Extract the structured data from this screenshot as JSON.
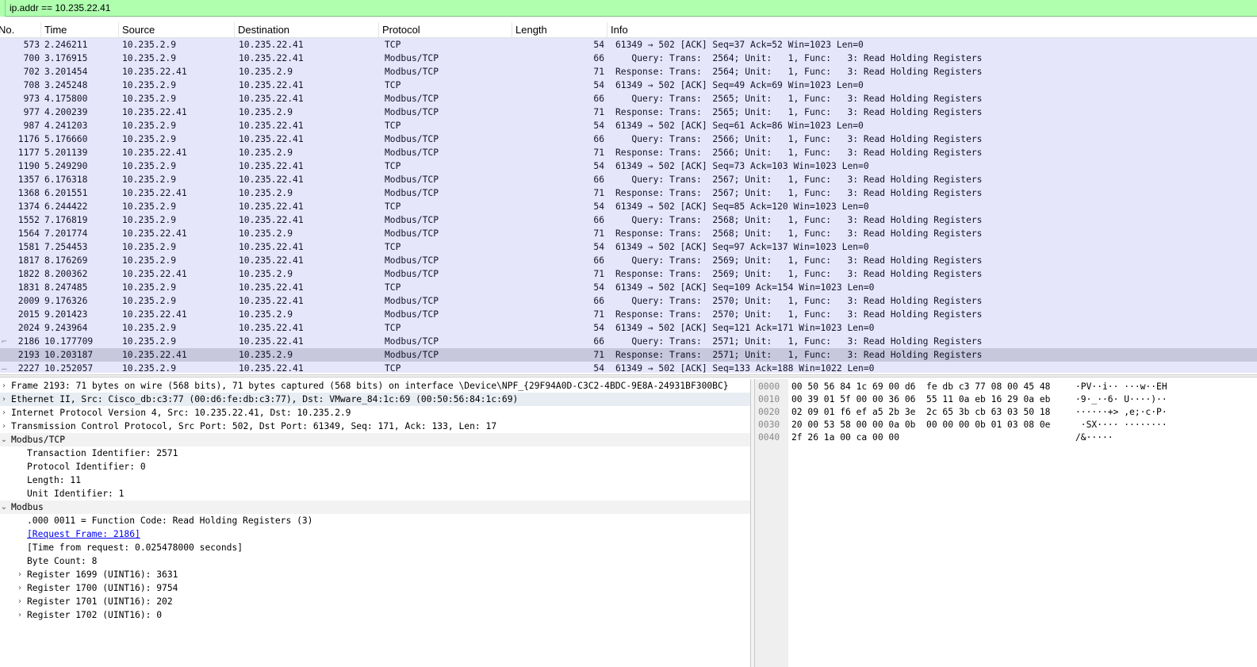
{
  "filter": {
    "value": "ip.addr == 10.235.22.41"
  },
  "packet_list": {
    "columns": {
      "no": "No.",
      "time": "Time",
      "source": "Source",
      "destination": "Destination",
      "protocol": "Protocol",
      "length": "Length",
      "info": "Info"
    },
    "rows": [
      {
        "no": "573",
        "time": "2.246211",
        "src": "10.235.2.9",
        "dst": "10.235.22.41",
        "proto": "TCP",
        "len": "54",
        "info": "61349 → 502 [ACK] Seq=37 Ack=52 Win=1023 Len=0"
      },
      {
        "no": "700",
        "time": "3.176915",
        "src": "10.235.2.9",
        "dst": "10.235.22.41",
        "proto": "Modbus/TCP",
        "len": "66",
        "info": "   Query: Trans:  2564; Unit:   1, Func:   3: Read Holding Registers"
      },
      {
        "no": "702",
        "time": "3.201454",
        "src": "10.235.22.41",
        "dst": "10.235.2.9",
        "proto": "Modbus/TCP",
        "len": "71",
        "info": "Response: Trans:  2564; Unit:   1, Func:   3: Read Holding Registers"
      },
      {
        "no": "708",
        "time": "3.245248",
        "src": "10.235.2.9",
        "dst": "10.235.22.41",
        "proto": "TCP",
        "len": "54",
        "info": "61349 → 502 [ACK] Seq=49 Ack=69 Win=1023 Len=0"
      },
      {
        "no": "973",
        "time": "4.175800",
        "src": "10.235.2.9",
        "dst": "10.235.22.41",
        "proto": "Modbus/TCP",
        "len": "66",
        "info": "   Query: Trans:  2565; Unit:   1, Func:   3: Read Holding Registers"
      },
      {
        "no": "977",
        "time": "4.200239",
        "src": "10.235.22.41",
        "dst": "10.235.2.9",
        "proto": "Modbus/TCP",
        "len": "71",
        "info": "Response: Trans:  2565; Unit:   1, Func:   3: Read Holding Registers"
      },
      {
        "no": "987",
        "time": "4.241203",
        "src": "10.235.2.9",
        "dst": "10.235.22.41",
        "proto": "TCP",
        "len": "54",
        "info": "61349 → 502 [ACK] Seq=61 Ack=86 Win=1023 Len=0"
      },
      {
        "no": "1176",
        "time": "5.176660",
        "src": "10.235.2.9",
        "dst": "10.235.22.41",
        "proto": "Modbus/TCP",
        "len": "66",
        "info": "   Query: Trans:  2566; Unit:   1, Func:   3: Read Holding Registers"
      },
      {
        "no": "1177",
        "time": "5.201139",
        "src": "10.235.22.41",
        "dst": "10.235.2.9",
        "proto": "Modbus/TCP",
        "len": "71",
        "info": "Response: Trans:  2566; Unit:   1, Func:   3: Read Holding Registers"
      },
      {
        "no": "1190",
        "time": "5.249290",
        "src": "10.235.2.9",
        "dst": "10.235.22.41",
        "proto": "TCP",
        "len": "54",
        "info": "61349 → 502 [ACK] Seq=73 Ack=103 Win=1023 Len=0"
      },
      {
        "no": "1357",
        "time": "6.176318",
        "src": "10.235.2.9",
        "dst": "10.235.22.41",
        "proto": "Modbus/TCP",
        "len": "66",
        "info": "   Query: Trans:  2567; Unit:   1, Func:   3: Read Holding Registers"
      },
      {
        "no": "1368",
        "time": "6.201551",
        "src": "10.235.22.41",
        "dst": "10.235.2.9",
        "proto": "Modbus/TCP",
        "len": "71",
        "info": "Response: Trans:  2567; Unit:   1, Func:   3: Read Holding Registers"
      },
      {
        "no": "1374",
        "time": "6.244422",
        "src": "10.235.2.9",
        "dst": "10.235.22.41",
        "proto": "TCP",
        "len": "54",
        "info": "61349 → 502 [ACK] Seq=85 Ack=120 Win=1023 Len=0"
      },
      {
        "no": "1552",
        "time": "7.176819",
        "src": "10.235.2.9",
        "dst": "10.235.22.41",
        "proto": "Modbus/TCP",
        "len": "66",
        "info": "   Query: Trans:  2568; Unit:   1, Func:   3: Read Holding Registers"
      },
      {
        "no": "1564",
        "time": "7.201774",
        "src": "10.235.22.41",
        "dst": "10.235.2.9",
        "proto": "Modbus/TCP",
        "len": "71",
        "info": "Response: Trans:  2568; Unit:   1, Func:   3: Read Holding Registers"
      },
      {
        "no": "1581",
        "time": "7.254453",
        "src": "10.235.2.9",
        "dst": "10.235.22.41",
        "proto": "TCP",
        "len": "54",
        "info": "61349 → 502 [ACK] Seq=97 Ack=137 Win=1023 Len=0"
      },
      {
        "no": "1817",
        "time": "8.176269",
        "src": "10.235.2.9",
        "dst": "10.235.22.41",
        "proto": "Modbus/TCP",
        "len": "66",
        "info": "   Query: Trans:  2569; Unit:   1, Func:   3: Read Holding Registers"
      },
      {
        "no": "1822",
        "time": "8.200362",
        "src": "10.235.22.41",
        "dst": "10.235.2.9",
        "proto": "Modbus/TCP",
        "len": "71",
        "info": "Response: Trans:  2569; Unit:   1, Func:   3: Read Holding Registers"
      },
      {
        "no": "1831",
        "time": "8.247485",
        "src": "10.235.2.9",
        "dst": "10.235.22.41",
        "proto": "TCP",
        "len": "54",
        "info": "61349 → 502 [ACK] Seq=109 Ack=154 Win=1023 Len=0"
      },
      {
        "no": "2009",
        "time": "9.176326",
        "src": "10.235.2.9",
        "dst": "10.235.22.41",
        "proto": "Modbus/TCP",
        "len": "66",
        "info": "   Query: Trans:  2570; Unit:   1, Func:   3: Read Holding Registers"
      },
      {
        "no": "2015",
        "time": "9.201423",
        "src": "10.235.22.41",
        "dst": "10.235.2.9",
        "proto": "Modbus/TCP",
        "len": "71",
        "info": "Response: Trans:  2570; Unit:   1, Func:   3: Read Holding Registers"
      },
      {
        "no": "2024",
        "time": "9.243964",
        "src": "10.235.2.9",
        "dst": "10.235.22.41",
        "proto": "TCP",
        "len": "54",
        "info": "61349 → 502 [ACK] Seq=121 Ack=171 Win=1023 Len=0"
      },
      {
        "no": "2186",
        "time": "10.177709",
        "src": "10.235.2.9",
        "dst": "10.235.22.41",
        "proto": "Modbus/TCP",
        "len": "66",
        "info": "   Query: Trans:  2571; Unit:   1, Func:   3: Read Holding Registers",
        "mark": "⌐"
      },
      {
        "no": "2193",
        "time": "10.203187",
        "src": "10.235.22.41",
        "dst": "10.235.2.9",
        "proto": "Modbus/TCP",
        "len": "71",
        "info": "Response: Trans:  2571; Unit:   1, Func:   3: Read Holding Registers",
        "selected": true
      },
      {
        "no": "2227",
        "time": "10.252057",
        "src": "10.235.2.9",
        "dst": "10.235.22.41",
        "proto": "TCP",
        "len": "54",
        "info": "61349 → 502 [ACK] Seq=133 Ack=188 Win=1022 Len=0",
        "mark": "–"
      }
    ]
  },
  "details": {
    "lines": [
      {
        "text": "Frame 2193: 71 bytes on wire (568 bits), 71 bytes captured (568 bits) on interface \\Device\\NPF_{29F94A0D-C3C2-4BDC-9E8A-24931BF300BC}",
        "arrow": "›",
        "indent": 0
      },
      {
        "text": "Ethernet II, Src: Cisco_db:c3:77 (00:d6:fe:db:c3:77), Dst: VMware_84:1c:69 (00:50:56:84:1c:69)",
        "arrow": "›",
        "indent": 0,
        "style": "hl"
      },
      {
        "text": "Internet Protocol Version 4, Src: 10.235.22.41, Dst: 10.235.2.9",
        "arrow": "›",
        "indent": 0
      },
      {
        "text": "Transmission Control Protocol, Src Port: 502, Dst Port: 61349, Seq: 171, Ack: 133, Len: 17",
        "arrow": "›",
        "indent": 0
      },
      {
        "text": "Modbus/TCP",
        "arrow": "⌄",
        "indent": 0,
        "style": "sec"
      },
      {
        "text": "Transaction Identifier: 2571",
        "indent": 1
      },
      {
        "text": "Protocol Identifier: 0",
        "indent": 1
      },
      {
        "text": "Length: 11",
        "indent": 1
      },
      {
        "text": "Unit Identifier: 1",
        "indent": 1
      },
      {
        "text": "Modbus",
        "arrow": "⌄",
        "indent": 0,
        "style": "sec"
      },
      {
        "text": ".000 0011 = Function Code: Read Holding Registers (3)",
        "indent": 1
      },
      {
        "text": "[Request Frame: 2186]",
        "indent": 1,
        "link": true
      },
      {
        "text": "[Time from request: 0.025478000 seconds]",
        "indent": 1
      },
      {
        "text": "Byte Count: 8",
        "indent": 1
      },
      {
        "text": "Register 1699 (UINT16): 3631",
        "arrow": "›",
        "indent": 1
      },
      {
        "text": "Register 1700 (UINT16): 9754",
        "arrow": "›",
        "indent": 1
      },
      {
        "text": "Register 1701 (UINT16): 202",
        "arrow": "›",
        "indent": 1
      },
      {
        "text": "Register 1702 (UINT16): 0",
        "arrow": "›",
        "indent": 1
      }
    ]
  },
  "bytes": {
    "lines": [
      {
        "offset": "0000",
        "hex": "00 50 56 84 1c 69 00 d6  fe db c3 77 08 00 45 48",
        "ascii": "·PV··i·· ···w··EH"
      },
      {
        "offset": "0010",
        "hex": "00 39 01 5f 00 00 36 06  55 11 0a eb 16 29 0a eb",
        "ascii": "·9·_··6· U····)··"
      },
      {
        "offset": "0020",
        "hex": "02 09 01 f6 ef a5 2b 3e  2c 65 3b cb 63 03 50 18",
        "ascii": "······+> ,e;·c·P·"
      },
      {
        "offset": "0030",
        "hex": "20 00 53 58 00 00 0a 0b  00 00 00 0b 01 03 08 0e",
        "ascii": " ·SX···· ········"
      },
      {
        "offset": "0040",
        "hex": "2f 26 1a 00 ca 00 00",
        "ascii": "/&·····"
      }
    ]
  },
  "colors": {
    "filter_bg": "#afffaf",
    "row_bg": "#e6e6fa",
    "row_selected_bg": "#c8c8dc",
    "link": "#0000ee"
  }
}
